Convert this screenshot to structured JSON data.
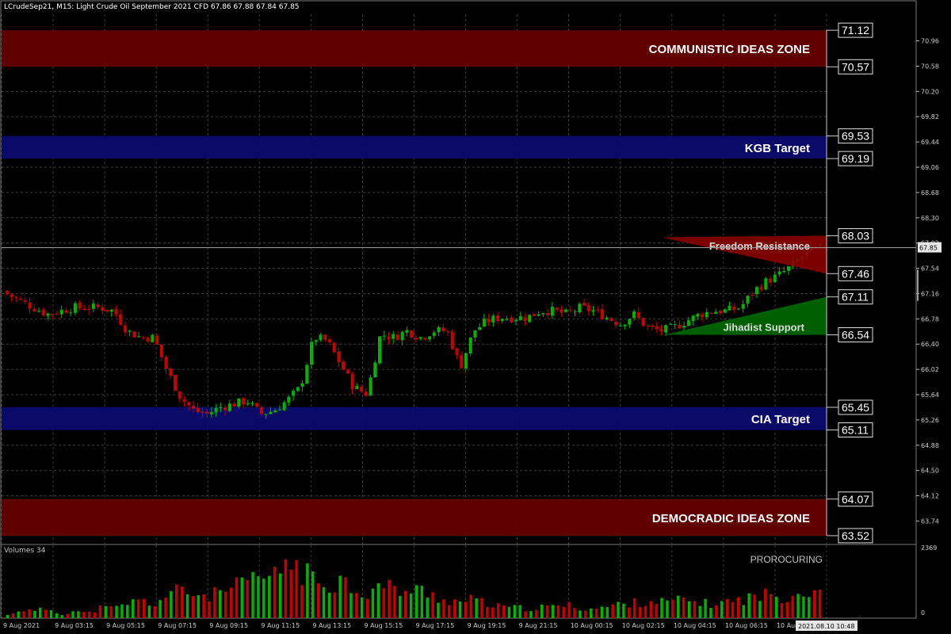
{
  "header": {
    "symbol_info": "LCrudeSep21, M15:  Light Crude Oil September 2021 CFD  67.86 67.88 67.84 67.85"
  },
  "volume_panel": {
    "title": "Volumes 34",
    "max_label": "2369",
    "zero_label": "0",
    "watermark": "PROROCURING"
  },
  "current_price": "67.85",
  "colors": {
    "background": "#000000",
    "grid": "#3a3a3a",
    "bull": "#00b400",
    "bear": "#c80000",
    "zone_red": "#650000",
    "zone_blue": "#0a0a6e",
    "highlight": "#ff00ff"
  },
  "zones": [
    {
      "label": "COMMUNISTIC IDEAS ZONE",
      "top": 71.12,
      "bottom": 70.57,
      "color": "#650000",
      "top_label": "71.12",
      "bottom_label": "70.57"
    },
    {
      "label": "KGB Target",
      "top": 69.53,
      "bottom": 69.19,
      "color": "#0a0a6e",
      "top_label": "69.53",
      "bottom_label": "69.19"
    },
    {
      "label": "CIA Target",
      "top": 65.45,
      "bottom": 65.11,
      "color": "#0a0a6e",
      "top_label": "65.45",
      "bottom_label": "65.11"
    },
    {
      "label": "DEMOCRADIC IDEAS ZONE",
      "top": 64.07,
      "bottom": 63.52,
      "color": "#650000",
      "top_label": "64.07",
      "bottom_label": "63.52"
    }
  ],
  "triangles": [
    {
      "label": "Freedom Resistance",
      "color": "#8b0000",
      "label_price": 67.88,
      "top_label": "68.03",
      "bottom_label": "67.46",
      "apex_price": 68.03,
      "base_price": 67.46
    },
    {
      "label": "Jihadist Support",
      "color": "#006400",
      "label_price": 66.66,
      "top_label": "67.11",
      "bottom_label": "66.54",
      "apex_price": 67.11,
      "base_price": 66.54
    }
  ],
  "chart_data": {
    "type": "candlestick",
    "price_axis": {
      "ylim": [
        63.4,
        71.36
      ],
      "ticks": [
        "70.96",
        "70.58",
        "70.20",
        "69.82",
        "69.44",
        "69.06",
        "68.68",
        "68.30",
        "67.92",
        "67.54",
        "67.16",
        "66.78",
        "66.40",
        "66.02",
        "65.64",
        "65.26",
        "64.88",
        "64.50",
        "64.12",
        "63.74"
      ]
    },
    "time_axis": {
      "labels": [
        "9 Aug 2021",
        "9 Aug 03:15",
        "9 Aug 05:15",
        "9 Aug 07:15",
        "9 Aug 09:15",
        "9 Aug 11:15",
        "9 Aug 13:15",
        "9 Aug 15:15",
        "9 Aug 17:15",
        "9 Aug 19:15",
        "9 Aug 21:15",
        "10 Aug 00:15",
        "10 Aug 02:15",
        "10 Aug 04:15",
        "10 Aug 06:15",
        "10 Aug 08:15"
      ],
      "current_time": "2021.08.10 10:48"
    },
    "close_path": [
      67.15,
      67.05,
      66.95,
      66.85,
      66.9,
      66.95,
      66.95,
      66.95,
      66.9,
      66.6,
      66.5,
      66.5,
      66.0,
      65.6,
      65.4,
      65.35,
      65.45,
      65.5,
      65.55,
      65.35,
      65.4,
      65.55,
      65.75,
      66.5,
      66.45,
      66.1,
      65.75,
      65.65,
      66.55,
      66.5,
      66.6,
      66.5,
      66.6,
      66.6,
      66.05,
      66.6,
      66.75,
      66.8,
      66.8,
      66.8,
      66.9,
      66.9,
      66.85,
      66.95,
      66.9,
      66.8,
      66.7,
      66.85,
      66.65,
      66.6,
      66.65,
      66.75,
      66.85,
      66.9,
      66.9,
      66.95,
      67.2,
      67.35,
      67.45,
      67.6,
      67.78,
      67.85
    ],
    "volumes": [
      120,
      360,
      260,
      400,
      150,
      300,
      180,
      420,
      380,
      600,
      700,
      560,
      900,
      1120,
      960,
      880,
      1000,
      1200,
      1400,
      1640,
      1560,
      2369,
      1880,
      1500,
      1360,
      1560,
      1200,
      960,
      1300,
      1180,
      1050,
      1100,
      900,
      700,
      650,
      750,
      560,
      440,
      420,
      380,
      420,
      460,
      530,
      400,
      380,
      450,
      560,
      600,
      700,
      640,
      680,
      720,
      600,
      560,
      650,
      720,
      850,
      920,
      840,
      980,
      1080,
      1150
    ]
  }
}
